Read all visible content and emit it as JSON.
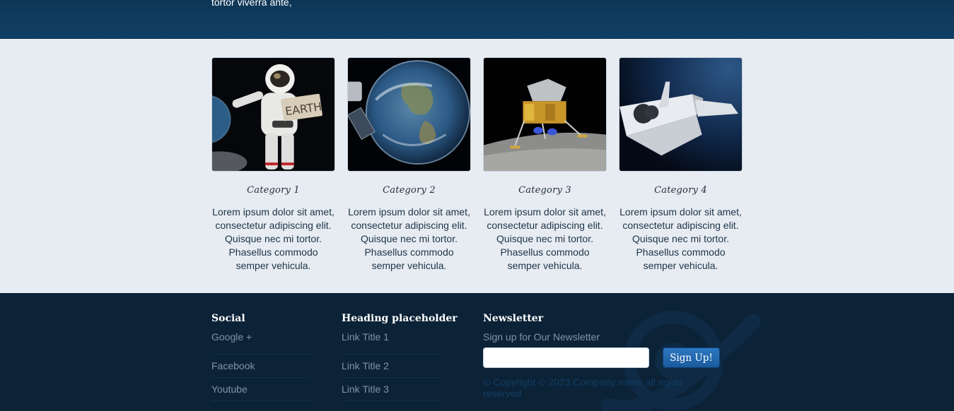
{
  "hero": {
    "text": "tortor viverra ante,"
  },
  "categories": [
    {
      "title": "Category 1",
      "description": "Lorem ipsum dolor sit amet, consectetur adipiscing elit. Quisque nec mi tortor. Phasellus commodo semper vehicula.",
      "image": "astronaut-earth-sign"
    },
    {
      "title": "Category 2",
      "description": "Lorem ipsum dolor sit amet, consectetur adipiscing elit. Quisque nec mi tortor. Phasellus commodo semper vehicula.",
      "image": "earth-from-space"
    },
    {
      "title": "Category 3",
      "description": "Lorem ipsum dolor sit amet, consectetur adipiscing elit. Quisque nec mi tortor. Phasellus commodo semper vehicula.",
      "image": "lunar-lander"
    },
    {
      "title": "Category 4",
      "description": "Lorem ipsum dolor sit amet, consectetur adipiscing elit. Quisque nec mi tortor. Phasellus commodo semper vehicula.",
      "image": "space-shuttle"
    }
  ],
  "footer": {
    "social": {
      "heading": "Social",
      "links": [
        "Google +",
        "Facebook",
        "Youtube"
      ]
    },
    "placeholder": {
      "heading": "Heading placeholder",
      "links": [
        "Link Title 1",
        "Link Title 2",
        "Link Title 3"
      ]
    },
    "newsletter": {
      "heading": "Newsletter",
      "subtitle": "Sign up for Our Newsletter",
      "input_value": "",
      "button_label": "Sign Up!",
      "copyright": "© Copyright © 2023.Company name all rights reserved"
    },
    "logo_icon": "planet-logo-icon"
  },
  "colors": {
    "hero_bg": "#0f3a5c",
    "content_bg": "#e6ecf2",
    "footer_bg": "#0b2237",
    "button": "#2468ad",
    "link_muted": "#8194a8"
  }
}
